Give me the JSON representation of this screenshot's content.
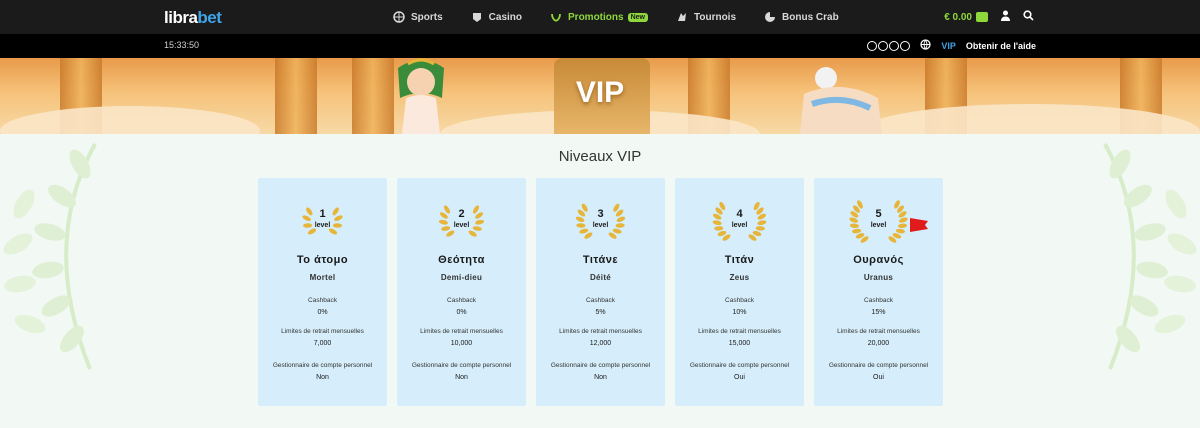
{
  "nav": {
    "logo_main": "libra",
    "logo_accent": "bet",
    "items": [
      {
        "label": "Sports",
        "icon": "sports-ball-icon"
      },
      {
        "label": "Casino",
        "icon": "casino-chip-icon"
      },
      {
        "label": "Promotions",
        "icon": "promotions-laurel-icon",
        "badge": "New",
        "active": true
      },
      {
        "label": "Tournois",
        "icon": "tournament-icon"
      },
      {
        "label": "Bonus Crab",
        "icon": "crab-claw-icon"
      }
    ],
    "balance": "€ 0.00"
  },
  "subbar": {
    "time": "15:33:50",
    "vip_link": "VIP",
    "help_link": "Obtenir de l'aide"
  },
  "banner": {
    "title": "VIP"
  },
  "section_title": "Niveaux VIP",
  "level_word": "level",
  "labels": {
    "cashback": "Cashback",
    "withdrawal": "Limites de retrait mensuelles",
    "manager": "Gestionnaire de compte personnel"
  },
  "levels": [
    {
      "num": "1",
      "greek": "Το άτομο",
      "name": "Mortel",
      "cashback": "0%",
      "withdrawal": "7,000",
      "manager": "Non"
    },
    {
      "num": "2",
      "greek": "Θεότητα",
      "name": "Demi-dieu",
      "cashback": "0%",
      "withdrawal": "10,000",
      "manager": "Non"
    },
    {
      "num": "3",
      "greek": "Τιτάνε",
      "name": "Déité",
      "cashback": "5%",
      "withdrawal": "12,000",
      "manager": "Non"
    },
    {
      "num": "4",
      "greek": "Τιτάν",
      "name": "Zeus",
      "cashback": "10%",
      "withdrawal": "15,000",
      "manager": "Oui"
    },
    {
      "num": "5",
      "greek": "Ουρανός",
      "name": "Uranus",
      "cashback": "15%",
      "withdrawal": "20,000",
      "manager": "Oui"
    }
  ],
  "colors": {
    "nav_bg": "#1b1b1b",
    "accent_green": "#8fd83b",
    "accent_blue": "#3fa3e8",
    "card_bg": "#d6eefb",
    "laurel_gold": "#e6b53a",
    "flag_red": "#e01b1b"
  }
}
